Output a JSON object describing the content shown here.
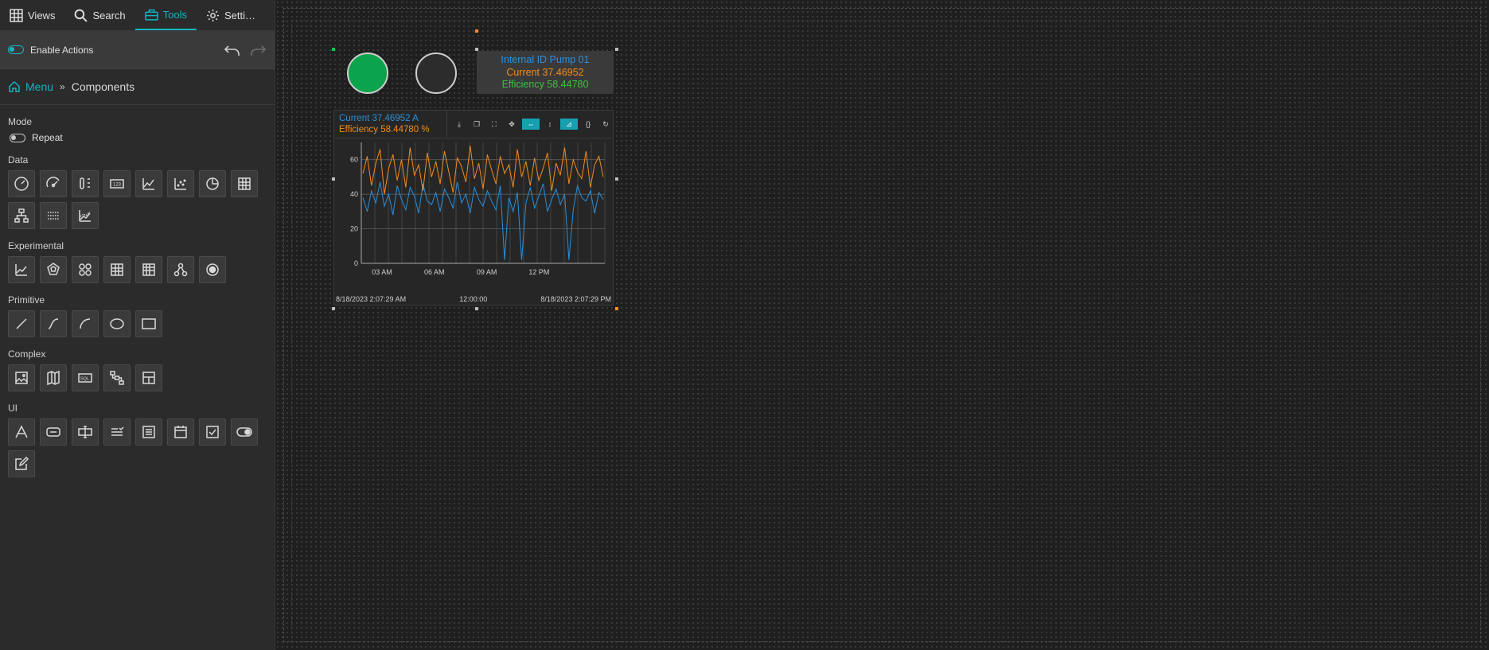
{
  "nav": {
    "tabs": [
      {
        "label": "Views",
        "icon": "grid-icon"
      },
      {
        "label": "Search",
        "icon": "search-icon"
      },
      {
        "label": "Tools",
        "icon": "toolbox-icon"
      },
      {
        "label": "Setti…",
        "icon": "gear-icon"
      }
    ]
  },
  "actions": {
    "label": "Enable Actions"
  },
  "breadcrumb": {
    "menu": "Menu",
    "current": "Components"
  },
  "sections": {
    "mode": "Mode",
    "repeat": "Repeat",
    "data": "Data",
    "experimental": "Experimental",
    "primitive": "Primitive",
    "complex": "Complex",
    "ui": "UI"
  },
  "widget": {
    "info_title": "Internal ID Pump 01",
    "info_current": "Current   37.46952",
    "info_efficiency": "Efficiency  58.44780",
    "legend_current": "Current    37.46952 A",
    "legend_efficiency": "Efficiency 58.44780 %",
    "footer_start": "8/18/2023 2:07:29 AM",
    "footer_mid": "12:00:00",
    "footer_end": "8/18/2023 2:07:29 PM"
  },
  "colors": {
    "accent": "#17b3c4",
    "current": "#2c8fd9",
    "efficiency": "#f28c1e",
    "led_on": "#0ba34b"
  },
  "chart_data": {
    "type": "line",
    "x_ticks": [
      "03 AM",
      "06 AM",
      "09 AM",
      "12 PM"
    ],
    "y_ticks": [
      0,
      20,
      40,
      60
    ],
    "ylim": [
      0,
      70
    ],
    "grid": true,
    "series": [
      {
        "name": "Current",
        "unit": "A",
        "color": "#2c8fd9",
        "values": [
          38,
          30,
          42,
          35,
          47,
          33,
          40,
          28,
          45,
          37,
          31,
          44,
          39,
          29,
          46,
          36,
          34,
          41,
          30,
          43,
          38,
          32,
          47,
          35,
          40,
          29,
          44,
          37,
          33,
          42,
          36,
          31,
          45,
          2,
          38,
          30,
          41,
          2,
          35,
          44,
          32,
          39,
          46,
          30,
          37,
          43,
          34,
          40,
          2,
          31,
          45,
          38,
          36,
          42,
          29,
          41,
          37
        ]
      },
      {
        "name": "Efficiency",
        "unit": "%",
        "color": "#f28c1e",
        "values": [
          52,
          62,
          45,
          58,
          66,
          40,
          55,
          63,
          48,
          60,
          44,
          67,
          51,
          57,
          42,
          64,
          50,
          59,
          46,
          65,
          53,
          41,
          61,
          56,
          47,
          68,
          49,
          58,
          43,
          63,
          54,
          46,
          62,
          52,
          57,
          44,
          66,
          50,
          59,
          45,
          61,
          48,
          55,
          64,
          42,
          58,
          51,
          67,
          46,
          60,
          53,
          49,
          65,
          44,
          57,
          62,
          50
        ]
      }
    ]
  }
}
